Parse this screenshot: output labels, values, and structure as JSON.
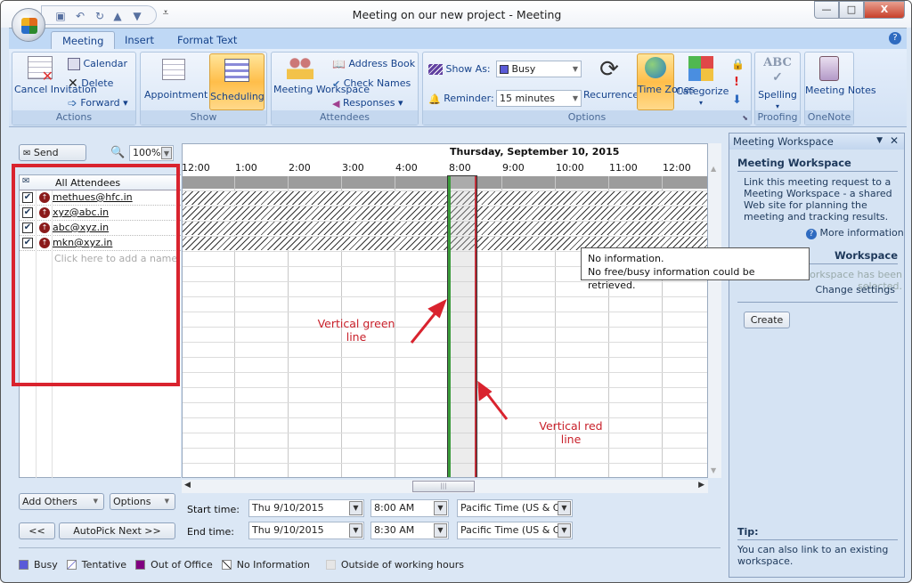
{
  "window": {
    "title": "Meeting on our new project - Meeting",
    "controls": {
      "minimize": "—",
      "maximize": "□",
      "close": "X"
    }
  },
  "quick_access": {
    "icons": [
      "save-icon",
      "undo-icon",
      "redo-icon",
      "up-icon",
      "down-icon",
      "customize-icon"
    ]
  },
  "tabs": [
    {
      "label": "Meeting",
      "active": true
    },
    {
      "label": "Insert"
    },
    {
      "label": "Format Text"
    }
  ],
  "ribbon": {
    "actions": {
      "label": "Actions",
      "cancel": "Cancel Invitation",
      "calendar": "Calendar",
      "delete": "Delete",
      "forward": "Forward"
    },
    "show": {
      "label": "Show",
      "appointment": "Appointment",
      "scheduling": "Scheduling"
    },
    "attendees": {
      "label": "Attendees",
      "meeting_workspace": "Meeting Workspace",
      "address_book": "Address Book",
      "check_names": "Check Names",
      "responses": "Responses"
    },
    "options": {
      "label": "Options",
      "show_as_label": "Show As:",
      "show_as_value": "Busy",
      "reminder_label": "Reminder:",
      "reminder_value": "15 minutes",
      "recurrence": "Recurrence",
      "time_zones": "Time Zones",
      "categorize": "Categorize"
    },
    "proofing": {
      "label": "Proofing",
      "spelling": "Spelling"
    },
    "onenote": {
      "label": "OneNote",
      "meeting_notes": "Meeting Notes"
    }
  },
  "scheduler": {
    "send": "Send",
    "zoom": "100%",
    "date_header": "Thursday, September 10, 2015",
    "hours": [
      "12:00",
      "1:00",
      "2:00",
      "3:00",
      "4:00",
      "8:00",
      "9:00",
      "10:00",
      "11:00",
      "12:00"
    ],
    "all_attendees": "All Attendees",
    "attendees": [
      {
        "email": "methues@hfc.in",
        "checked": true
      },
      {
        "email": "xyz@abc.in",
        "checked": true
      },
      {
        "email": "abc@xyz.in",
        "checked": true
      },
      {
        "email": "mkn@xyz.in",
        "checked": true
      }
    ],
    "add_name_placeholder": "Click here to add a name",
    "tooltip": {
      "line1": "No information.",
      "line2": "No free/busy information could be retrieved."
    },
    "add_others": "Add Others",
    "options": "Options",
    "prev": "<<",
    "autopick": "AutoPick Next >>",
    "start_label": "Start time:",
    "start_date": "Thu 9/10/2015",
    "start_time": "8:00 AM",
    "start_tz": "Pacific Time (US & Ca",
    "end_label": "End time:",
    "end_date": "Thu 9/10/2015",
    "end_time": "8:30 AM",
    "end_tz": "Pacific Time (US & Ca"
  },
  "legend": [
    {
      "label": "Busy",
      "color": "#5a5ad8"
    },
    {
      "label": "Tentative",
      "color": "#b8b8e8"
    },
    {
      "label": "Out of Office",
      "color": "#800080"
    },
    {
      "label": "No Information",
      "color": "#333333"
    },
    {
      "label": "Outside of working hours",
      "color": "#e6e6e6"
    }
  ],
  "annotations": {
    "green": "Vertical green line",
    "red": "Vertical red line"
  },
  "pane": {
    "title": "Meeting Workspace",
    "heading": "Meeting Workspace",
    "description": "Link this meeting request to a Meeting Workspace - a shared Web site for planning the meeting and tracking results.",
    "more_info": "More information",
    "section2": "Workspace",
    "section2_text": "No workspace has been selected.",
    "change_settings": "Change settings",
    "create": "Create",
    "tip_label": "Tip:",
    "tip_text": "You can also link to an existing workspace."
  }
}
